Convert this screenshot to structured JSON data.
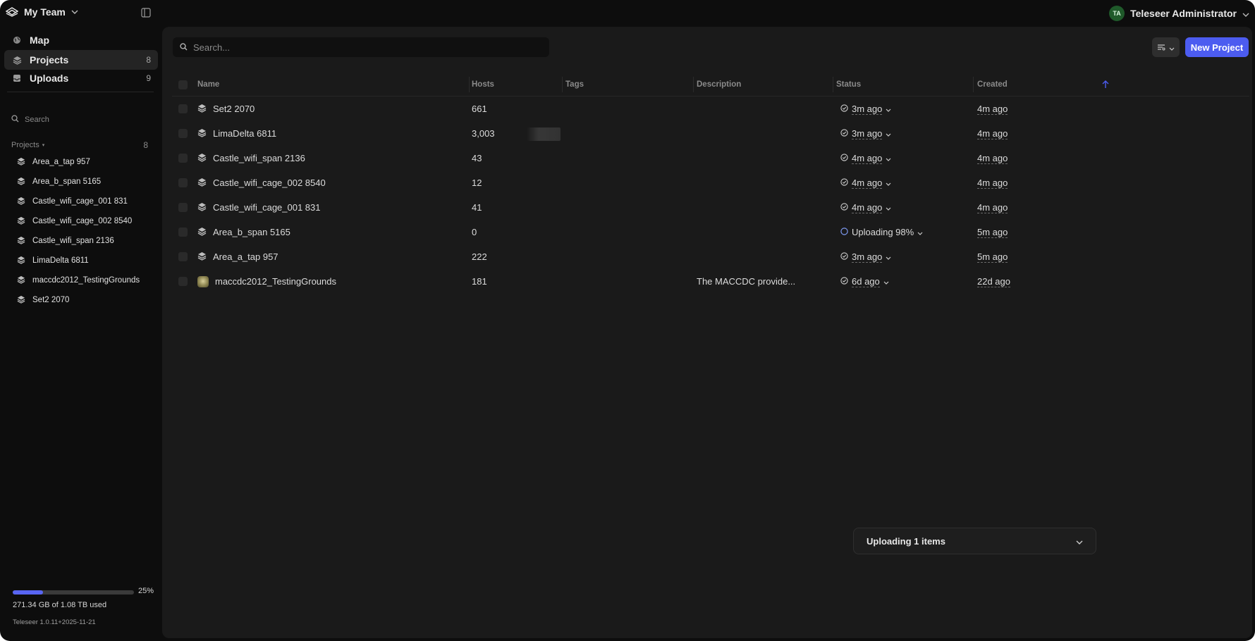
{
  "topbar": {
    "team_name": "My Team",
    "user_initials": "TA",
    "user_name": "Teleseer Administrator"
  },
  "sidebar": {
    "nav": [
      {
        "label": "Map",
        "count": ""
      },
      {
        "label": "Projects",
        "count": "8"
      },
      {
        "label": "Uploads",
        "count": "9"
      }
    ],
    "search_placeholder": "Search",
    "projects_heading": "Projects",
    "projects_count": "8",
    "projects": [
      "Area_a_tap 957",
      "Area_b_span 5165",
      "Castle_wifi_cage_001 831",
      "Castle_wifi_cage_002 8540",
      "Castle_wifi_span 2136",
      "LimaDelta 6811",
      "maccdc2012_TestingGrounds",
      "Set2 2070"
    ],
    "storage": {
      "fraction_used": 0.25,
      "percent_label": "25%",
      "usage_text": "271.34 GB of 1.08 TB used",
      "version": "Teleseer 1.0.11+2025-11-21"
    }
  },
  "main": {
    "search_placeholder": "Search...",
    "new_project_label": "New Project",
    "columns": [
      "Name",
      "Hosts",
      "Tags",
      "Description",
      "Status",
      "Created"
    ],
    "rows": [
      {
        "name": "Set2 2070",
        "hosts": "661",
        "tags": "",
        "description": "",
        "status": "3m ago",
        "created": "4m ago",
        "icon": "layers-icon"
      },
      {
        "name": "LimaDelta 6811",
        "hosts": "3,003",
        "tags": "",
        "description": "",
        "status": "3m ago",
        "created": "4m ago",
        "icon": "layers-icon"
      },
      {
        "name": "Castle_wifi_span 2136",
        "hosts": "43",
        "tags": "",
        "description": "",
        "status": "4m ago",
        "created": "4m ago",
        "icon": "layers-icon"
      },
      {
        "name": "Castle_wifi_cage_002 8540",
        "hosts": "12",
        "tags": "",
        "description": "",
        "status": "4m ago",
        "created": "4m ago",
        "icon": "layers-icon"
      },
      {
        "name": "Castle_wifi_cage_001 831",
        "hosts": "41",
        "tags": "",
        "description": "",
        "status": "4m ago",
        "created": "4m ago",
        "icon": "layers-icon"
      },
      {
        "name": "Area_b_span 5165",
        "hosts": "0",
        "tags": "",
        "description": "",
        "status": "Uploading 98%",
        "created": "5m ago",
        "icon": "layers-icon",
        "uploading": true
      },
      {
        "name": "Area_a_tap 957",
        "hosts": "222",
        "tags": "",
        "description": "",
        "status": "3m ago",
        "created": "5m ago",
        "icon": "layers-icon"
      },
      {
        "name": "maccdc2012_TestingGrounds",
        "hosts": "181",
        "tags": "",
        "description": "The MACCDC provide...",
        "status": "6d ago",
        "created": "22d ago",
        "icon": "project-thumbnail"
      }
    ]
  },
  "toast": {
    "label": "Uploading 1 items"
  },
  "colors": {
    "accent": "#4c5cf0",
    "background": "#0d0d0d",
    "panel": "#1a1a1a"
  }
}
